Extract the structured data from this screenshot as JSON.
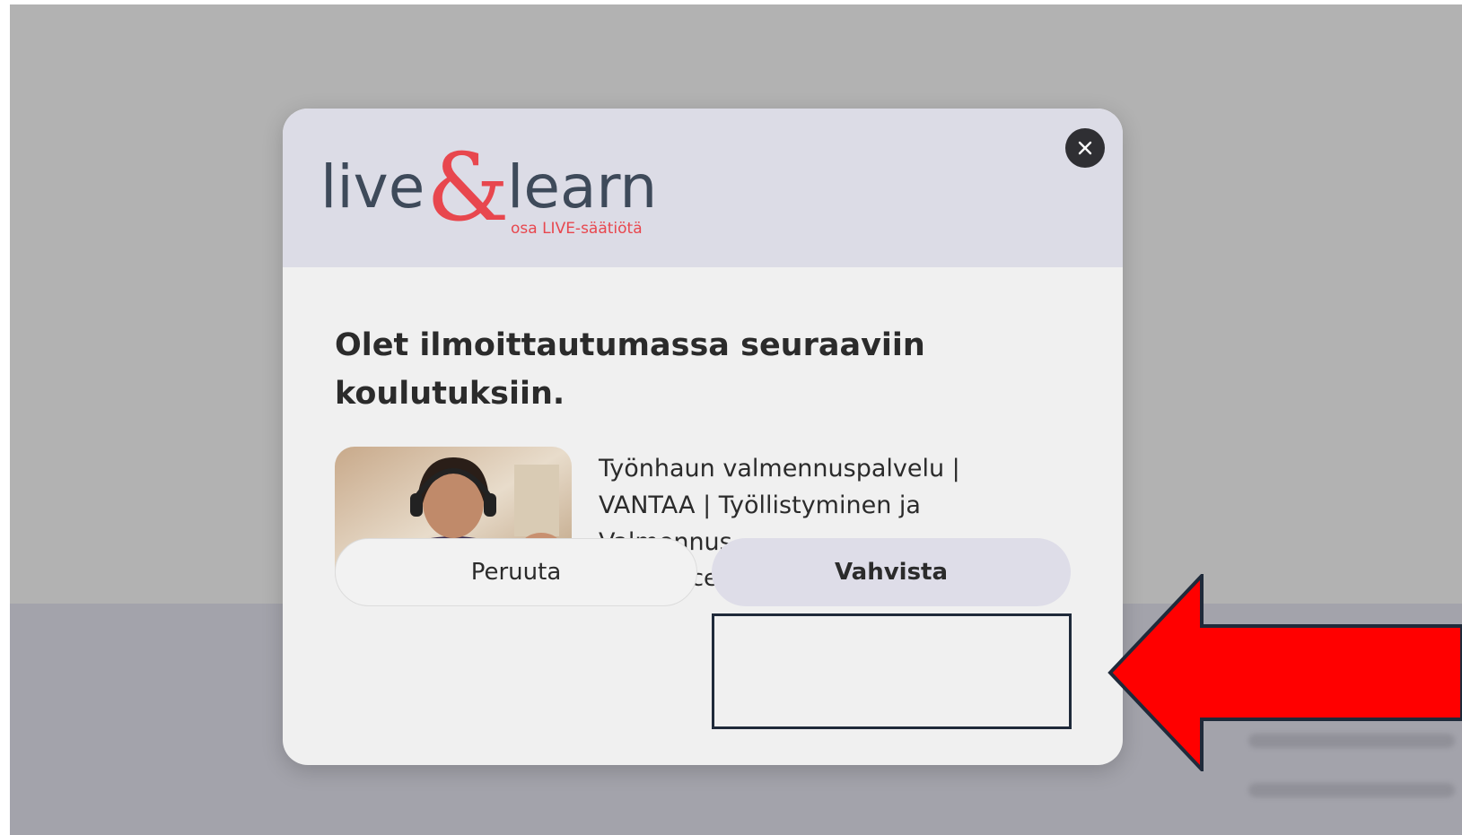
{
  "modal": {
    "logo": {
      "word_left": "live",
      "ampersand": "&",
      "word_right": "learn",
      "tagline": "osa LIVE-säätiötä"
    },
    "close_icon": "close-icon",
    "title": "Olet ilmoittautumassa seuraaviin koulutuksiin.",
    "course": {
      "title": "Työnhaun valmennuspalvelu | VANTAA | Työllistyminen ja Valmennus",
      "location": "Howspace -työtila",
      "thumbnail": "woman-with-headset-photo"
    },
    "buttons": {
      "cancel_label": "Peruuta",
      "confirm_label": "Vahvista"
    }
  },
  "annotation": {
    "arrow_color": "#ff0000",
    "box_color": "#1f2a3a"
  },
  "colors": {
    "brand_dark": "#3e4a5a",
    "brand_red": "#e8474e",
    "header_bg": "#dcdce6"
  }
}
